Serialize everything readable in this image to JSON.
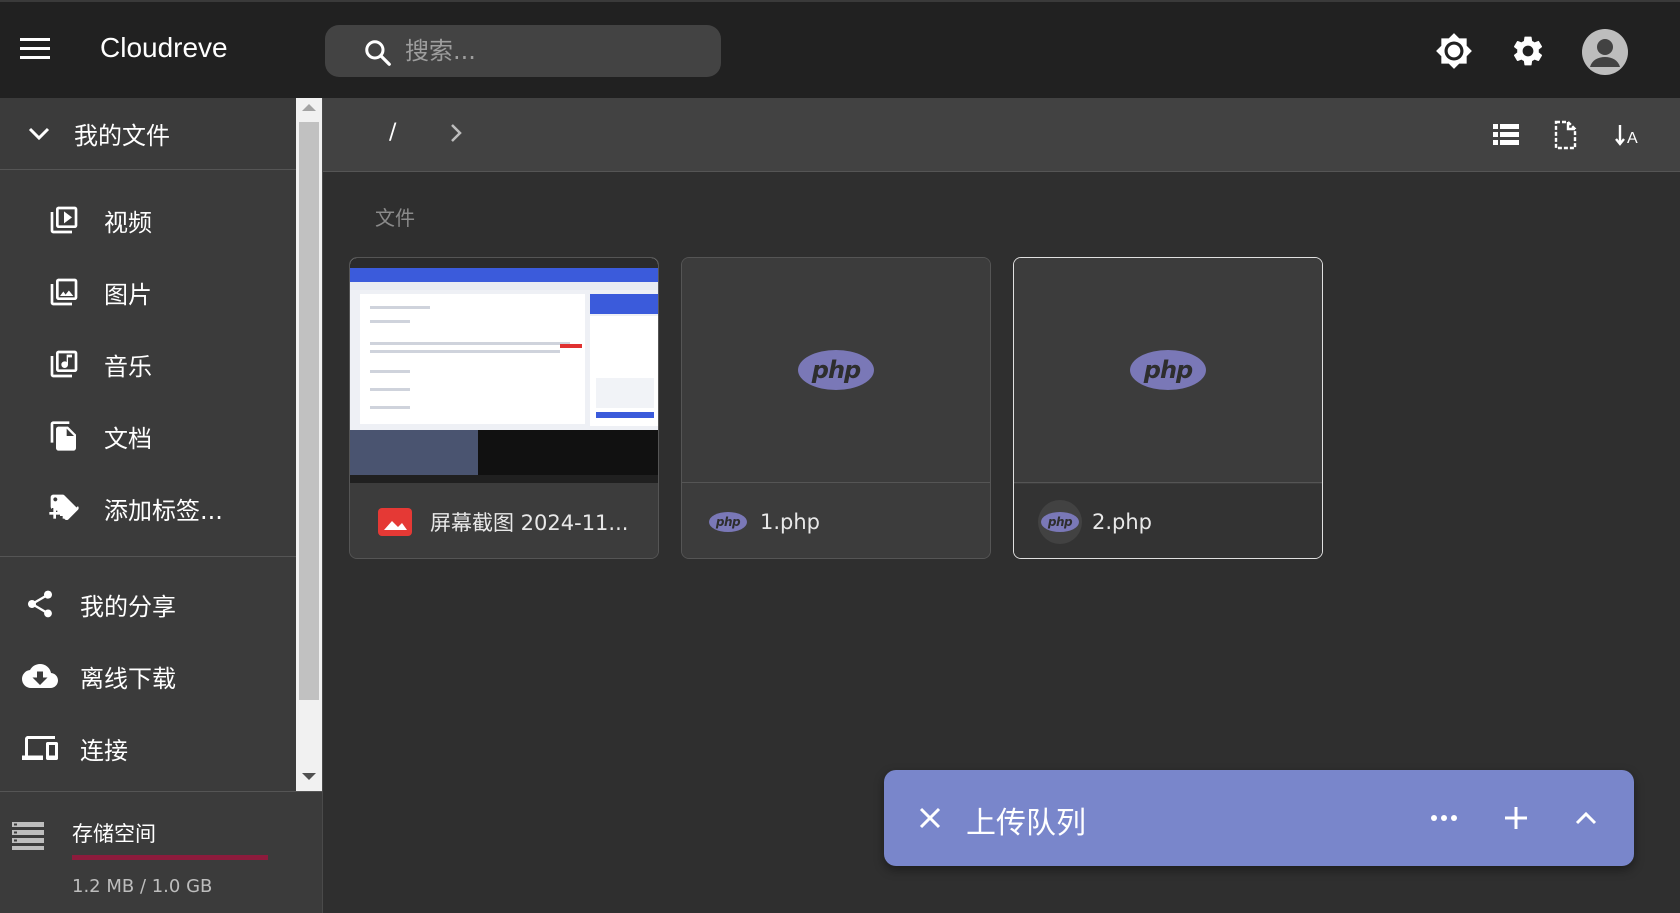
{
  "app": {
    "title": "Cloudreve"
  },
  "search": {
    "placeholder": "搜索..."
  },
  "sidebar": {
    "header": "我的文件",
    "categories": [
      {
        "label": "视频",
        "icon": "video-library-icon"
      },
      {
        "label": "图片",
        "icon": "photo-library-icon"
      },
      {
        "label": "音乐",
        "icon": "music-library-icon"
      },
      {
        "label": "文档",
        "icon": "documents-icon"
      },
      {
        "label": "添加标签...",
        "icon": "add-tag-icon"
      }
    ],
    "items": [
      {
        "label": "我的分享",
        "icon": "share-icon"
      },
      {
        "label": "离线下载",
        "icon": "cloud-download-icon"
      },
      {
        "label": "连接",
        "icon": "devices-icon"
      }
    ]
  },
  "storage": {
    "label": "存储空间",
    "usage": "1.2 MB / 1.0 GB",
    "bar_color": "#8c1b3c"
  },
  "breadcrumb": {
    "root": "/"
  },
  "main": {
    "section_title": "文件",
    "files": [
      {
        "name": "屏幕截图 2024-11...",
        "type": "image"
      },
      {
        "name": "1.php",
        "type": "php"
      },
      {
        "name": "2.php",
        "type": "php"
      }
    ]
  },
  "php_label": "php",
  "upload_queue": {
    "title": "上传队列",
    "accent": "#7986cb"
  }
}
